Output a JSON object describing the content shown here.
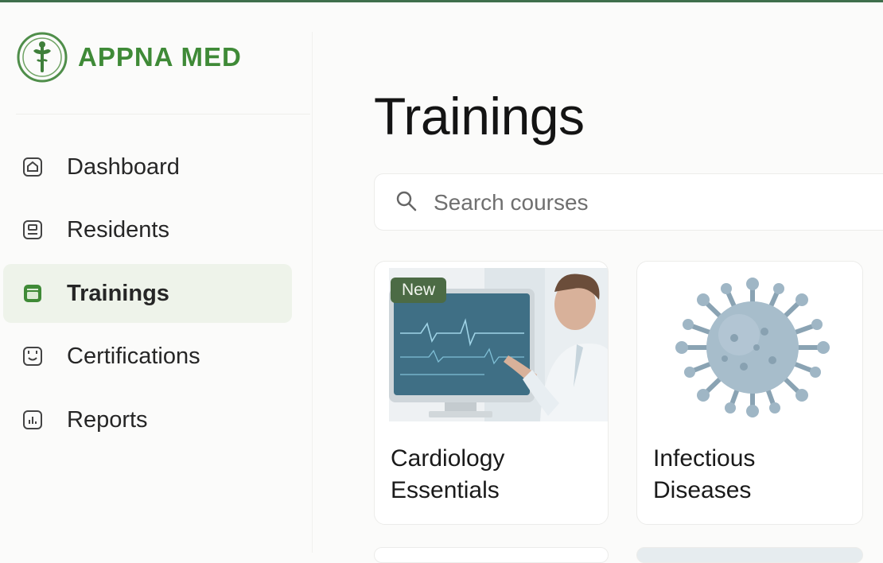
{
  "brand": {
    "name": "APPNA MED",
    "color": "#3f8a37"
  },
  "nav": {
    "items": [
      {
        "label": "Dashboard",
        "icon": "home-icon",
        "active": false
      },
      {
        "label": "Residents",
        "icon": "badge-icon",
        "active": false
      },
      {
        "label": "Trainings",
        "icon": "training-icon",
        "active": true
      },
      {
        "label": "Certifications",
        "icon": "certificate-icon",
        "active": false
      },
      {
        "label": "Reports",
        "icon": "reports-icon",
        "active": false
      }
    ]
  },
  "main": {
    "title": "Trainings",
    "search": {
      "placeholder": "Search courses",
      "value": ""
    },
    "courses": [
      {
        "title": "Cardiology Essentials",
        "badge": "New",
        "image": "doctor-monitor-image"
      },
      {
        "title": "Infectious Diseases",
        "badge": "",
        "image": "virus-image"
      }
    ]
  },
  "colors": {
    "accent": "#3f8a37",
    "active_bg": "#eef3ea",
    "badge_bg": "#4c6b45"
  }
}
